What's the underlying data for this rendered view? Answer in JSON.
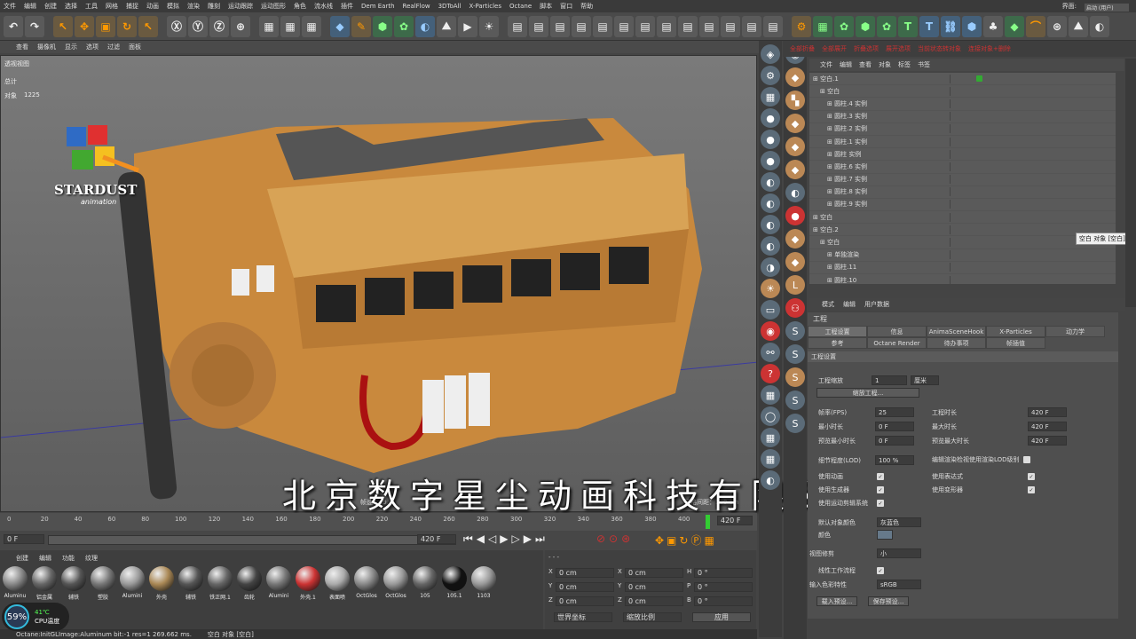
{
  "menubar": {
    "items": [
      "文件",
      "编辑",
      "创建",
      "选择",
      "工具",
      "网格",
      "捕捉",
      "动画",
      "模拟",
      "渲染",
      "雕刻",
      "运动跟踪",
      "运动图形",
      "角色",
      "流水线",
      "插件",
      "Dem Earth",
      "RealFlow",
      "3DToAll",
      "X-Particles",
      "Octane",
      "脚本",
      "窗口",
      "帮助"
    ],
    "interface_label": "界面:",
    "interface_value": "启动 (用户)"
  },
  "viewport": {
    "menu": [
      "查看",
      "摄像机",
      "显示",
      "选项",
      "过滤",
      "面板"
    ],
    "label": "透视视图",
    "stats": {
      "total_label": "总计",
      "object_label": "对象",
      "object_value": "1225"
    },
    "grid_info": "网格间距：100 cm",
    "logo_text": "STARDUST",
    "logo_sub": "animation",
    "subtitle": "北京数字星尘动画科技有限公司",
    "frame_label": "帧速 : 19.6"
  },
  "object_manager": {
    "header": [
      "全部折叠",
      "全部展开",
      "折叠选项",
      "展开选项",
      "当前状态转对象",
      "连接对象+删除"
    ],
    "menu": [
      "文件",
      "编辑",
      "查看",
      "对象",
      "标签",
      "书签"
    ],
    "tree": [
      {
        "name": "空白.1",
        "indent": 0,
        "tag": true
      },
      {
        "name": "空白",
        "indent": 1,
        "tag": false
      },
      {
        "name": "圆柱.4 实例",
        "indent": 2,
        "tag": false
      },
      {
        "name": "圆柱.3 实例",
        "indent": 2,
        "tag": false
      },
      {
        "name": "圆柱.2 实例",
        "indent": 2,
        "tag": false
      },
      {
        "name": "圆柱.1 实例",
        "indent": 2,
        "tag": false
      },
      {
        "name": "圆柱 实例",
        "indent": 2,
        "tag": false
      },
      {
        "name": "圆柱.6 实例",
        "indent": 2,
        "tag": false
      },
      {
        "name": "圆柱.7 实例",
        "indent": 2,
        "tag": false
      },
      {
        "name": "圆柱.8 实例",
        "indent": 2,
        "tag": false
      },
      {
        "name": "圆柱.9 实例",
        "indent": 2,
        "tag": false
      },
      {
        "name": "空白",
        "indent": 0,
        "tag": false
      },
      {
        "name": "空白.2",
        "indent": 0,
        "tag": false
      },
      {
        "name": "空白",
        "indent": 1,
        "tag": false
      },
      {
        "name": "单独渲染",
        "indent": 2,
        "tag": false
      },
      {
        "name": "圆柱.11",
        "indent": 2,
        "tag": false
      },
      {
        "name": "圆柱.10",
        "indent": 2,
        "tag": false
      }
    ],
    "tooltip": "空白 对象 [空白]"
  },
  "attributes": {
    "menu": [
      "模式",
      "编辑",
      "用户数据"
    ],
    "title": "工程",
    "tabs_row1": [
      "工程设置",
      "信息",
      "AnimaSceneHook",
      "X-Particles",
      "动力学"
    ],
    "tabs_row2": [
      "参考",
      "Octane Render",
      "待办事项",
      "帧插值"
    ],
    "section": "工程设置",
    "scale_label": "工程缩放",
    "scale_value": "1",
    "scale_unit": "厘米",
    "scale_button": "缩放工程...",
    "fps_label": "帧率(FPS)",
    "fps_value": "25",
    "min_time_label": "最小时长",
    "min_time_value": "0 F",
    "preview_min_label": "预览最小时长",
    "preview_min_value": "0 F",
    "project_time_label": "工程时长",
    "project_time_value": "420 F",
    "max_time_label": "最大时长",
    "max_time_value": "420 F",
    "preview_max_label": "预览最大时长",
    "preview_max_value": "420 F",
    "lod_label": "细节程度(LOD)",
    "lod_value": "100 %",
    "lod_render_label": "编辑渲染检视使用渲染LOD级别",
    "use_anim_label": "使用动画",
    "use_expr_label": "使用表达式",
    "use_gen_label": "使用生成器",
    "use_deform_label": "使用变形器",
    "use_motion_label": "使用运动剪辑系统",
    "default_color_label": "默认对象颜色",
    "default_color_value": "灰蓝色",
    "color_label": "颜色",
    "view_clip_label": "视图修剪",
    "view_clip_value": "小",
    "linear_label": "线性工作流程",
    "input_color_label": "输入色彩特性",
    "input_color_value": "sRGB",
    "load_preset": "载入预设...",
    "save_preset": "保存预设..."
  },
  "timeline": {
    "ticks": [
      "0",
      "20",
      "40",
      "60",
      "80",
      "100",
      "120",
      "140",
      "160",
      "180",
      "200",
      "220",
      "240",
      "260",
      "280",
      "300",
      "320",
      "340",
      "360",
      "380",
      "400"
    ],
    "end_frame": "420 F",
    "start_field": "0 F",
    "end_field": "420 F",
    "current": "0 F"
  },
  "materials": {
    "menu": [
      "创建",
      "编辑",
      "功能",
      "纹理"
    ],
    "row1": [
      "Aluminu",
      "铝金属",
      "辅铁",
      "塑胶",
      "Alumini",
      "外壳",
      "辅铁",
      "铁正网.1",
      "齿轮",
      "Alumini",
      "外壳.1",
      "表面喷",
      "OctGlos",
      "OctGlos",
      "105",
      "105.1",
      "1103"
    ],
    "row1_colors": [
      "#888",
      "#666",
      "#555",
      "#777",
      "#999",
      "#a85",
      "#555",
      "#666",
      "#444",
      "#777",
      "#c33",
      "#aaa",
      "#888",
      "#999",
      "#666",
      "#111",
      "#999"
    ]
  },
  "coordinates": {
    "labels": [
      "X",
      "Y",
      "Z"
    ],
    "pos": [
      "0 cm",
      "0 cm",
      "0 cm"
    ],
    "size": [
      "0 cm",
      "0 cm",
      "0 cm"
    ],
    "rot_labels": [
      "H",
      "P",
      "B"
    ],
    "rot": [
      "0 °",
      "0 °",
      "0 °"
    ],
    "world": "世界坐标",
    "scale": "缩放比例",
    "apply": "应用"
  },
  "status": {
    "left": "Octane:InitGLImage:Aluminum  bit:-1 res=1  269.662 ms.",
    "right": "空白 对象 [空白]"
  },
  "cpu": {
    "pct": "59%",
    "temp": "41℃",
    "label": "CPU温度"
  }
}
